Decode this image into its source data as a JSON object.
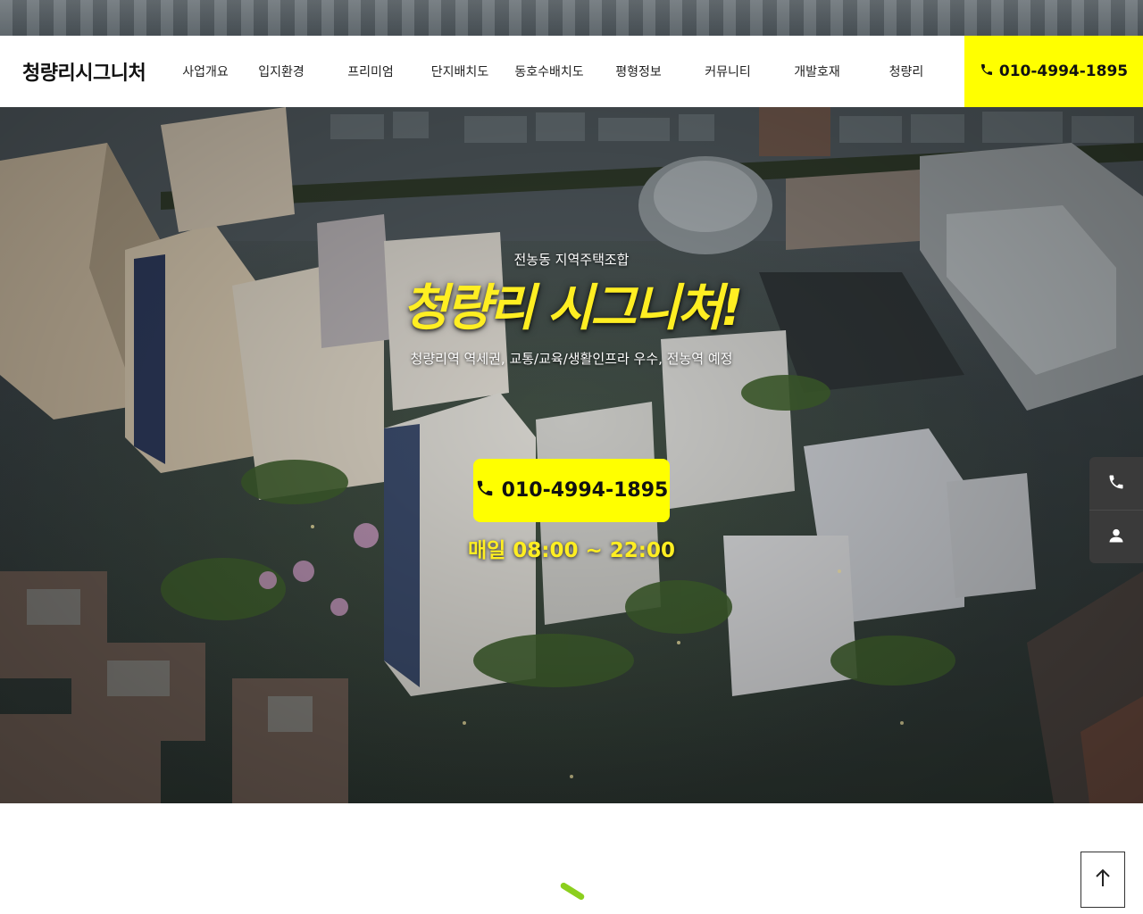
{
  "header": {
    "logo": "청량리시그니처",
    "nav": [
      "사업개요",
      "입지환경",
      "프리미엄",
      "단지배치도",
      "동호수배치도",
      "평형정보",
      "커뮤니티",
      "개발호재",
      "청량리"
    ],
    "phone": "010-4994-1895"
  },
  "hero": {
    "subtitle": "전농동 지역주택조합",
    "title": "청량리 시그니처!",
    "description": "청량리역 역세권, 교통/교육/생활인프라 우수, 전농역 예정",
    "cta_phone": "010-4994-1895",
    "hours": "매일 08:00 ~ 22:00"
  },
  "side_buttons": {
    "call": "phone-icon",
    "contact": "person-icon"
  },
  "colors": {
    "accent": "#ffff00",
    "title_yellow": "#ffee22",
    "side_bg": "#3a3a3a",
    "loader_green": "#8ccf1e"
  }
}
